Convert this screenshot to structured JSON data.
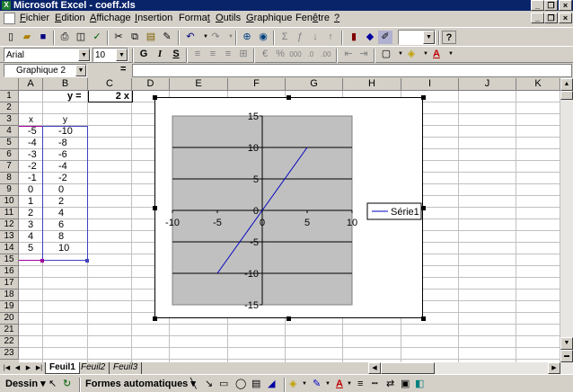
{
  "window": {
    "title": "Microsoft Excel - coeff.xls",
    "app_icon": "excel-icon"
  },
  "menu": {
    "items": [
      {
        "label": "Fichier",
        "u": "F",
        "rest": "ichier"
      },
      {
        "label": "Edition",
        "u": "E",
        "rest": "dition"
      },
      {
        "label": "Affichage",
        "u": "A",
        "rest": "ffichage"
      },
      {
        "label": "Insertion",
        "u": "I",
        "rest": "nsertion"
      },
      {
        "label": "Format",
        "pre": "Forma",
        "u": "t",
        "rest": ""
      },
      {
        "label": "Outils",
        "u": "O",
        "rest": "utils"
      },
      {
        "label": "Graphique",
        "u": "G",
        "rest": "raphique"
      },
      {
        "label": "Fenêtre",
        "pre": "Fen",
        "u": "ê",
        "rest": "tre"
      },
      {
        "label": "?",
        "u": "?",
        "rest": ""
      }
    ]
  },
  "format_toolbar": {
    "font_name": "Arial",
    "font_size": "10",
    "bold": "G",
    "italic": "I",
    "underline": "S"
  },
  "formula_bar": {
    "name_box": "Graphique 2",
    "equals": "=",
    "formula": ""
  },
  "columns": [
    "A",
    "B",
    "C",
    "D",
    "E",
    "F",
    "G",
    "H",
    "I",
    "J",
    "K"
  ],
  "rows": [
    "1",
    "2",
    "3",
    "4",
    "5",
    "6",
    "7",
    "8",
    "9",
    "10",
    "11",
    "12",
    "13",
    "14",
    "15",
    "16",
    "17",
    "18",
    "19",
    "20",
    "21",
    "22",
    "23"
  ],
  "cells": {
    "B1": "y  =",
    "C1": "2  x",
    "A3": "x",
    "B3": "y",
    "x_values": [
      "-5",
      "-4",
      "-3",
      "-2",
      "-1",
      "0",
      "1",
      "2",
      "3",
      "4",
      "5"
    ],
    "y_values": [
      "-10",
      "-8",
      "-6",
      "-4",
      "-2",
      "0",
      "2",
      "4",
      "6",
      "8",
      "10"
    ]
  },
  "chart_data": {
    "type": "line",
    "series": [
      {
        "name": "Série1",
        "x": [
          -5,
          -4,
          -3,
          -2,
          -1,
          0,
          1,
          2,
          3,
          4,
          5
        ],
        "y": [
          -10,
          -8,
          -6,
          -4,
          -2,
          0,
          2,
          4,
          6,
          8,
          10
        ],
        "color": "#0000c0"
      }
    ],
    "xlim": [
      -10,
      10
    ],
    "ylim": [
      -15,
      15
    ],
    "xticks": [
      "-10",
      "-5",
      "0",
      "5",
      "10"
    ],
    "yticks": [
      "15",
      "10",
      "5",
      "0",
      "-5",
      "-10",
      "-15"
    ],
    "plot_area_color": "#c0c0c0",
    "grid": true,
    "legend": "right"
  },
  "sheets": {
    "tabs": [
      "Feuil1",
      "Feuil2",
      "Feuil3"
    ],
    "active": "Feuil1"
  },
  "drawing_toolbar": {
    "dessin": "Dessin",
    "formes": "Formes automatiques"
  }
}
